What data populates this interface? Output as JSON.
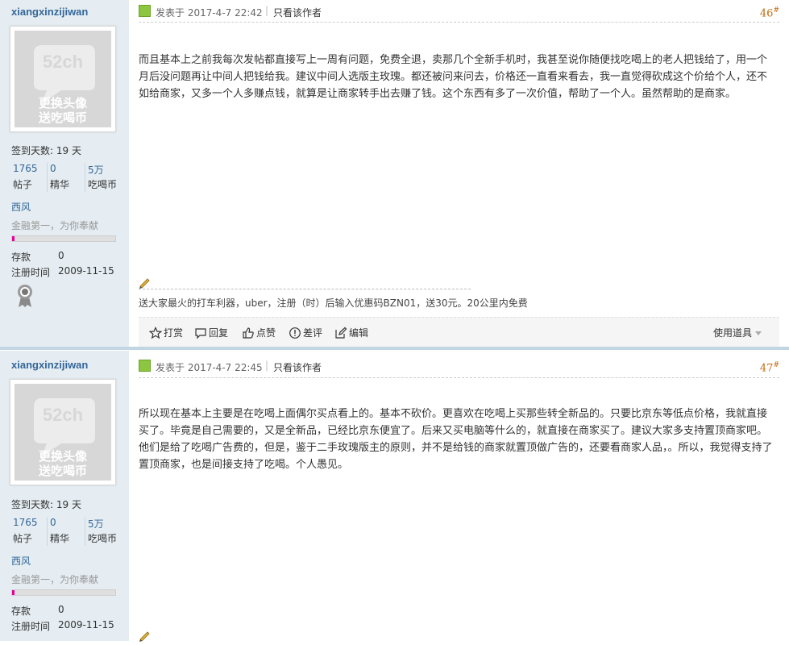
{
  "posts": [
    {
      "author": {
        "username": "xiangxinzijiwan",
        "avatar_text_line1": "更换头像",
        "avatar_text_line2": "送吃喝币",
        "avatar_logo": "52ch",
        "checkin": "签到天数: 19 天",
        "stats": [
          {
            "value": "1765",
            "label": "帖子"
          },
          {
            "value": "0",
            "label": "精华"
          },
          {
            "value": "5万",
            "label": "吃喝币"
          }
        ],
        "group": "西风",
        "slogan": "金融第一，为你奉献",
        "rank_progress": 0.02,
        "deposit_label": "存款",
        "deposit_value": "0",
        "register_label": "注册时间",
        "register_value": "2009-11-15",
        "medal_icon": "medal-icon"
      },
      "time": "发表于 2017-4-7 22:42",
      "separator": "|",
      "only_author": "只看该作者",
      "floor": "46",
      "floor_mark": "#",
      "message": "而且基本上之前我每次发帖都直接写上一周有问题，免费全退，卖那几个全新手机时，我甚至说你随便找吃喝上的老人把钱给了，用一个月后没问题再让中间人把钱给我。建议中间人选版主玫瑰。都还被问来问去，价格还一直看来看去，我一直觉得砍成这个价给个人，还不如给商家，又多一个人多赚点钱，就算是让商家转手出去赚了钱。这个东西有多了一次价值，帮助了一个人。虽然帮助的是商家。",
      "signature": "送大家最火的打车利器，uber，注册（时）后输入优惠码BZN01，送30元。20公里内免费",
      "actions": {
        "shang": "打赏",
        "reply": "回复",
        "like": "点赞",
        "dislike": "差评",
        "edit": "编辑",
        "use_tool": "使用道具"
      }
    },
    {
      "author": {
        "username": "xiangxinzijiwan",
        "avatar_text_line1": "更换头像",
        "avatar_text_line2": "送吃喝币",
        "avatar_logo": "52ch",
        "checkin": "签到天数: 19 天",
        "stats": [
          {
            "value": "1765",
            "label": "帖子"
          },
          {
            "value": "0",
            "label": "精华"
          },
          {
            "value": "5万",
            "label": "吃喝币"
          }
        ],
        "group": "西风",
        "slogan": "金融第一，为你奉献",
        "rank_progress": 0.02,
        "deposit_label": "存款",
        "deposit_value": "0",
        "register_label": "注册时间",
        "register_value": "2009-11-15"
      },
      "time": "发表于 2017-4-7 22:45",
      "separator": "|",
      "only_author": "只看该作者",
      "floor": "47",
      "floor_mark": "#",
      "message": "所以现在基本上主要是在吃喝上面偶尔买点看上的。基本不砍价。更喜欢在吃喝上买那些转全新品的。只要比京东等低点价格，我就直接买了。毕竟是自己需要的，又是全新品，已经比京东便宜了。后来又买电脑等什么的，就直接在商家买了。建议大家多支持置顶商家吧。他们是给了吃喝广告费的，但是，鉴于二手玫瑰版主的原则，并不是给钱的商家就置顶做广告的，还要看商家人品，。所以，我觉得支持了置顶商家，也是间接支持了吃喝。个人愚见。"
    }
  ],
  "colors": {
    "sidebar_bg": "#e5edf2",
    "username": "#336699",
    "floor": "#c26b0c",
    "rank_fill": "#e6009a",
    "separator": "#c2d5e3"
  }
}
